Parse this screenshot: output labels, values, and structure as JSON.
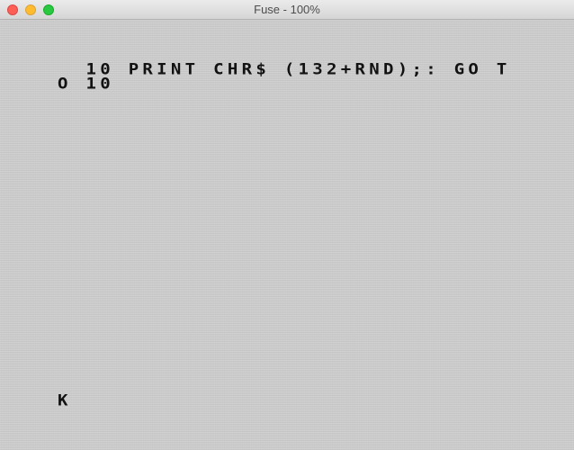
{
  "window": {
    "title": "Fuse - 100%"
  },
  "screen": {
    "lines": [
      "  10 PRINT CHR$ (132+RND);: GO T",
      "O 10"
    ],
    "cursor": "K"
  },
  "colors": {
    "screen_bg": "#cfcfcf",
    "text": "#111111",
    "close": "#fd5f57",
    "minimize": "#febc2e",
    "zoom": "#28c840"
  }
}
